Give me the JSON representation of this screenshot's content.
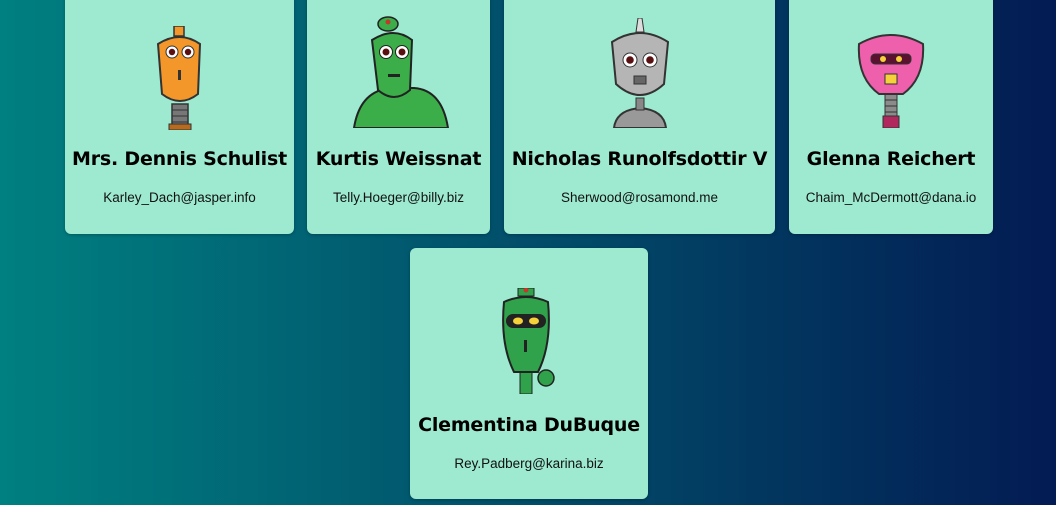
{
  "robots": [
    {
      "name": "Mrs. Dennis Schulist",
      "email": "Karley_Dach@jasper.info",
      "avatar": "orange-robot-icon",
      "color": "#f3972a"
    },
    {
      "name": "Kurtis Weissnat",
      "email": "Telly.Hoeger@billy.biz",
      "avatar": "green-robot-icon",
      "color": "#3bae4a"
    },
    {
      "name": "Nicholas Runolfsdottir V",
      "email": "Sherwood@rosamond.me",
      "avatar": "silver-robot-icon",
      "color": "#a9a9a9"
    },
    {
      "name": "Glenna Reichert",
      "email": "Chaim_McDermott@dana.io",
      "avatar": "pink-robot-icon",
      "color": "#ee5fac"
    },
    {
      "name": "Clementina DuBuque",
      "email": "Rey.Padberg@karina.biz",
      "avatar": "green-robot-visor-icon",
      "color": "#31a24c"
    }
  ],
  "colors": {
    "card_background": "#9dead0",
    "gradient_start": "#008080",
    "gradient_end": "#031b53"
  }
}
